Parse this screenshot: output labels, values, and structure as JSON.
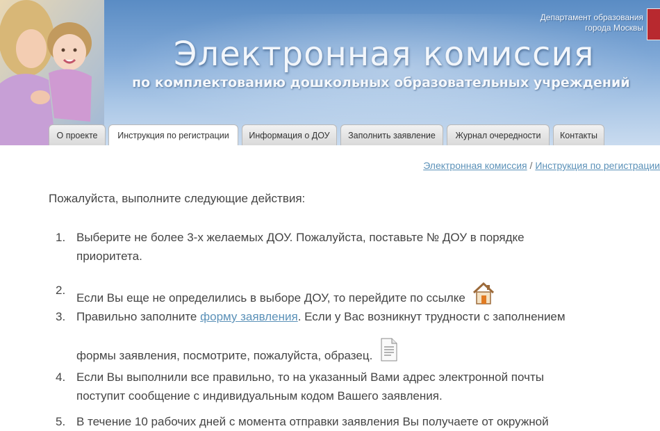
{
  "header": {
    "title": "Электронная комиссия",
    "subtitle": "по комплектованию дошкольных образовательных учреждений",
    "department_line1": "Департамент образования",
    "department_line2": "города Москвы"
  },
  "tabs": [
    {
      "label": "О проекте"
    },
    {
      "label": "Инструкция по регистрации",
      "active": true
    },
    {
      "label": "Информация о ДОУ"
    },
    {
      "label": "Заполнить заявление"
    },
    {
      "label": "Журнал очередности"
    },
    {
      "label": "Контакты"
    }
  ],
  "breadcrumb": {
    "home": "Электронная комиссия",
    "separator": " / ",
    "current": "Инструкция по регистрации"
  },
  "content": {
    "intro": "Пожалуйста, выполните следующие действия:",
    "steps": [
      {
        "num": "1.",
        "line1": "Выберите не более 3-х желаемых ДОУ. Пожалуйста, поставьте № ДОУ в порядке",
        "line2": "приоритета."
      },
      {
        "num": "2.",
        "text": "Если Вы еще не определились в выборе ДОУ, то перейдите по ссылке",
        "icon": "home-icon"
      },
      {
        "num": "3.",
        "before_link": "Правильно заполните ",
        "link": "форму заявления",
        "after_link": ". Если у Вас возникнут трудности с заполнением",
        "line2": "формы заявления, посмотрите, пожалуйста, образец.",
        "icon": "document-icon"
      },
      {
        "num": "4.",
        "line1": "Если Вы выполнили все правильно, то на указанный Вами адрес электронной почты",
        "line2": "поступит сообщение с индивидуальным кодом Вашего заявления."
      },
      {
        "num": "5.",
        "line1": "В течение 10 рабочих дней с момента отправки заявления Вы получаете от окружной"
      }
    ]
  },
  "colors": {
    "link": "#5b91b8",
    "header_blue": "#7ea7d6",
    "text": "#444444"
  }
}
